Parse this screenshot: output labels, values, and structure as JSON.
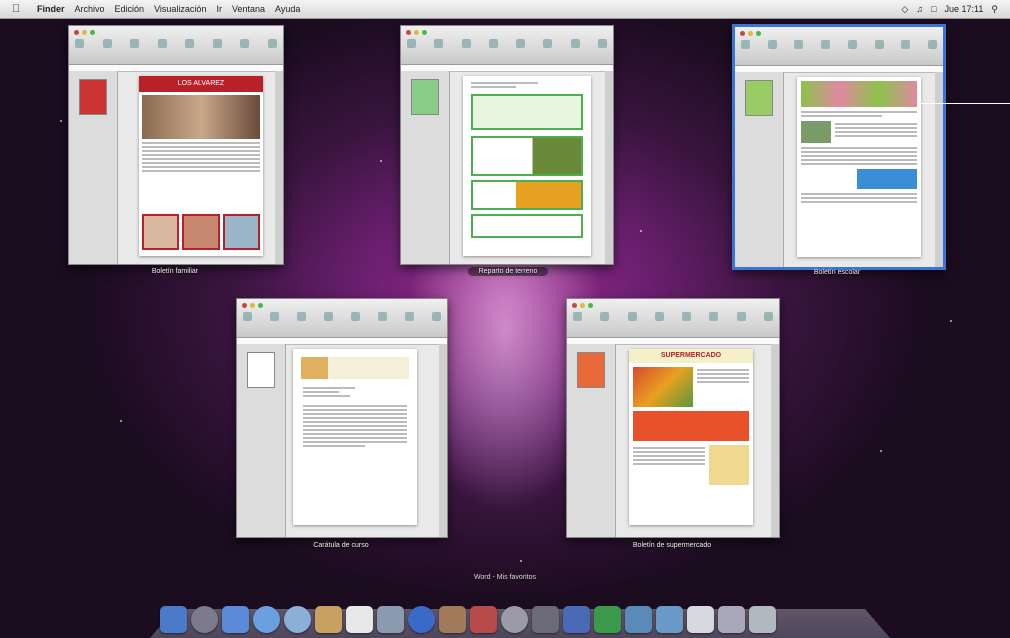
{
  "menubar": {
    "apple": "",
    "items": [
      "Finder",
      "Archivo",
      "Edición",
      "Visualización",
      "Ir",
      "Ventana",
      "Ayuda"
    ],
    "right": [
      "Jue 17:11"
    ]
  },
  "windows": [
    {
      "caption": "Boletín familiar",
      "title": "LOS ALVAREZ"
    },
    {
      "caption": "Reparto de terreno"
    },
    {
      "caption": "Boletín escolar"
    },
    {
      "caption": "Carátula de curso"
    },
    {
      "caption": "Boletín de supermercado",
      "title": "SUPERMERCADO"
    }
  ],
  "status": "Word - Mis favoritos",
  "colors": {
    "accent_blue": "#3a74d6",
    "desktop_purple": "#9b2a8e"
  }
}
